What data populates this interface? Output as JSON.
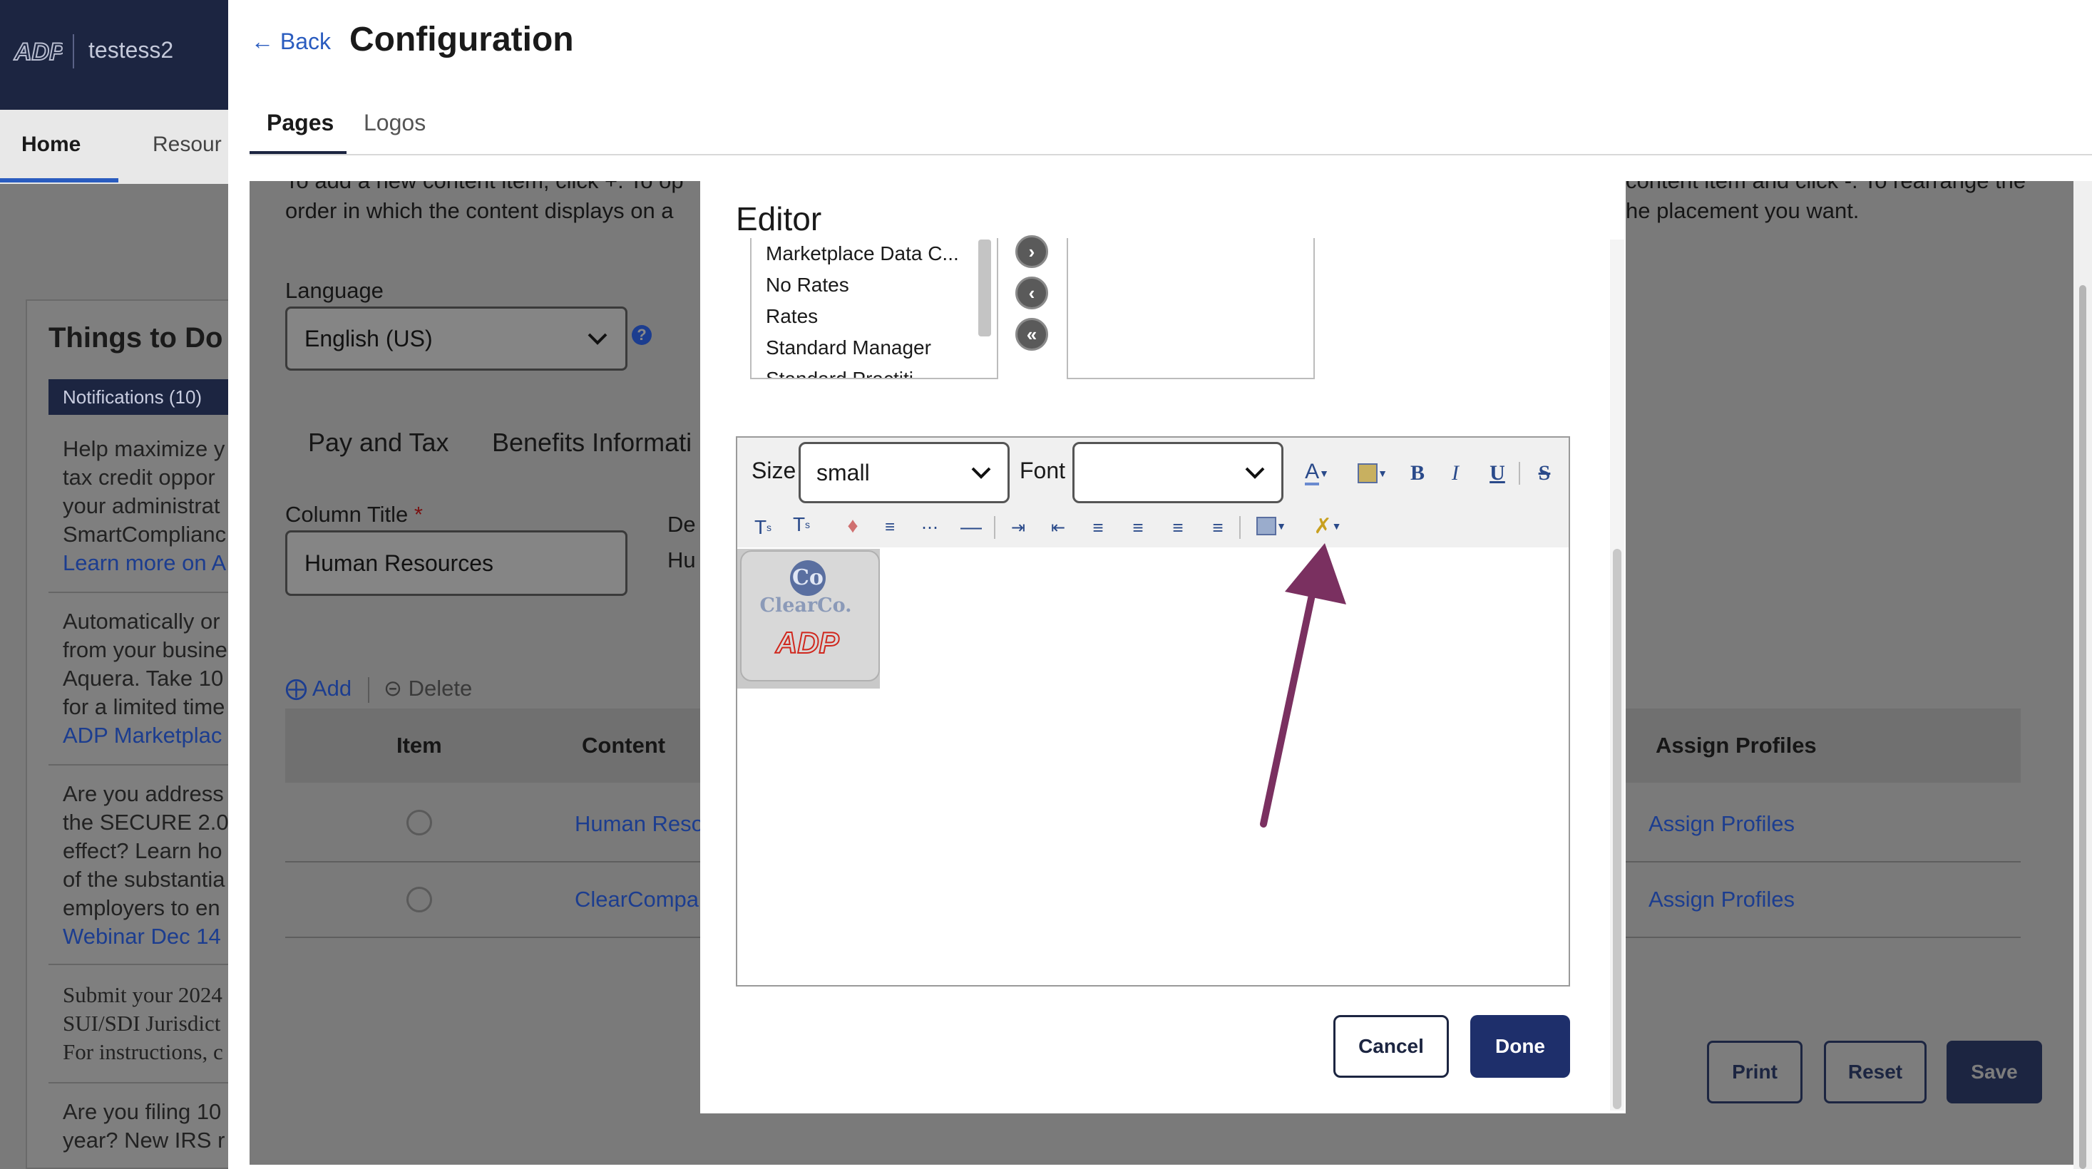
{
  "app": {
    "company": "testess2",
    "nav": {
      "home": "Home",
      "resources": "Resour"
    }
  },
  "things_to_do": {
    "title": "Things to Do",
    "notifications_tab": "Notifications (10)",
    "items": [
      {
        "lines": [
          "Help maximize y",
          "tax credit oppor",
          "your administrat",
          "SmartComplianc"
        ],
        "link": "Learn more on A"
      },
      {
        "lines": [
          "Automatically or",
          "from your busine",
          "Aquera. Take 10",
          "for a limited time"
        ],
        "link": "ADP Marketplac"
      },
      {
        "lines": [
          "Are you address",
          "the SECURE 2.0",
          "effect? Learn ho",
          "of the substantia",
          "employers to en"
        ],
        "link": "Webinar Dec 14"
      },
      {
        "lines": [
          "Submit your 2024",
          "SUI/SDI Jurisdict",
          "For instructions, c"
        ],
        "link": ""
      },
      {
        "lines": [
          "Are you filing 10",
          "year? New IRS r"
        ],
        "link": ""
      }
    ]
  },
  "header": {
    "back": "Back",
    "title": "Configuration",
    "tabs": {
      "pages": "Pages",
      "logos": "Logos"
    }
  },
  "config": {
    "instruction_line1_left": "To add a new content item, click +. To op",
    "instruction_line2_left": "order in which the content displays on a",
    "instruction_line1_right": "content item and click -. To rearrange the",
    "instruction_line2_right": "he placement you want.",
    "language_label": "Language",
    "language_value": "English (US)",
    "section_tabs": {
      "pay_tax": "Pay and Tax",
      "benefits": "Benefits Informati"
    },
    "column_title_label": "Column Title",
    "required_mark": "*",
    "column_title_value": "Human Resources",
    "desc_label": "De",
    "desc_value": "Hu",
    "add": "Add",
    "delete": "Delete",
    "table": {
      "headers": {
        "item": "Item",
        "content": "Content",
        "assign": "Assign Profiles"
      },
      "rows": [
        {
          "content": "Human Reso",
          "assign": "Assign Profiles"
        },
        {
          "content": "ClearCompa",
          "assign": "Assign Profiles"
        }
      ]
    },
    "buttons": {
      "print": "Print",
      "reset": "Reset",
      "save": "Save"
    }
  },
  "editor_modal": {
    "title": "Editor",
    "available_items": [
      "Marketplace Data C...",
      "No Rates",
      "Rates",
      "Standard Manager",
      "Standard Practiti"
    ],
    "toolbar": {
      "size_label": "Size",
      "size_value": "small",
      "font_label": "Font",
      "font_value": ""
    },
    "logo": {
      "top": "Co",
      "middle": "ClearCo.",
      "bottom": "ADP"
    },
    "annotation_arrow_color": "#7a3060",
    "buttons": {
      "cancel": "Cancel",
      "done": "Done"
    }
  },
  "colors": {
    "navy": "#1c2541",
    "link_blue": "#2a5cbf",
    "overlay_gray": "#7a7a7a",
    "adp_red": "#d0271d"
  }
}
